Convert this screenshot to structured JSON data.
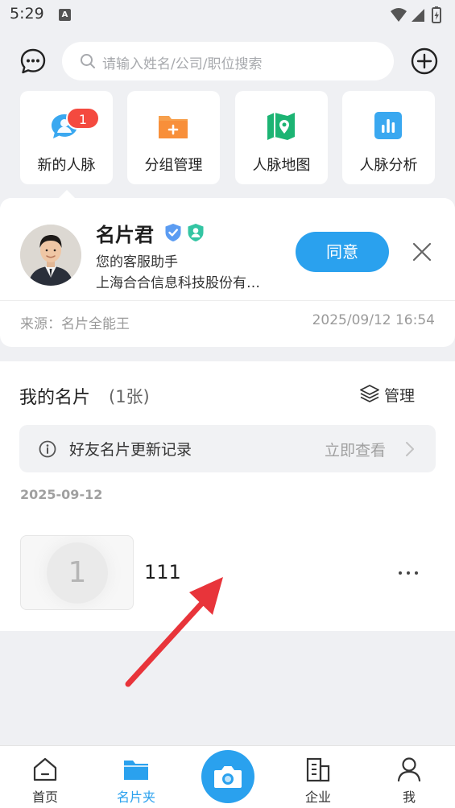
{
  "status_bar": {
    "time": "5:29",
    "notification_icon": "A"
  },
  "header": {
    "search_placeholder": "请输入姓名/公司/职位搜索"
  },
  "quick_tiles": [
    {
      "label": "新的人脉",
      "icon": "chat-bubbles-icon",
      "badge": "1"
    },
    {
      "label": "分组管理",
      "icon": "folder-plus-icon"
    },
    {
      "label": "人脉地图",
      "icon": "map-pin-icon"
    },
    {
      "label": "人脉分析",
      "icon": "bar-chart-icon"
    }
  ],
  "request": {
    "name": "名片君",
    "title": "您的客服助手",
    "company": "上海合合信息科技股份有…",
    "agree_label": "同意",
    "source": "来源：名片全能王",
    "time": "2025/09/12 16:54"
  },
  "my_cards": {
    "title": "我的名片",
    "count": "(1张)",
    "manage_label": "管理",
    "update_text": "好友名片更新记录",
    "update_link": "立即查看",
    "date": "2025-09-12",
    "cards": [
      {
        "initial": "1",
        "name": "111"
      }
    ]
  },
  "bottom_nav": [
    {
      "label": "首页",
      "icon": "home-icon",
      "active": false
    },
    {
      "label": "名片夹",
      "icon": "folder-icon",
      "active": true
    },
    {
      "label": "企业",
      "icon": "building-icon",
      "active": false
    },
    {
      "label": "我",
      "icon": "person-icon",
      "active": false
    }
  ],
  "colors": {
    "accent": "#2aa1ee",
    "badge": "#f44a3f",
    "annotation_arrow": "#e8343a"
  }
}
